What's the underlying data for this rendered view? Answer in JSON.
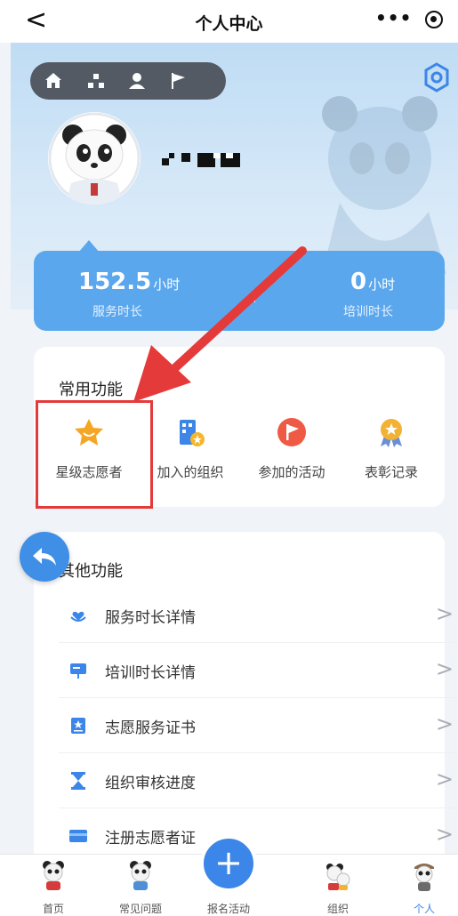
{
  "nav": {
    "back_glyph": "<",
    "title": "个人中心",
    "more_glyph": "•••",
    "icons": [
      "home-icon",
      "org-icon",
      "user-icon",
      "flag-icon"
    ]
  },
  "profile": {
    "name_masked": "▪▀ ▀▀▄"
  },
  "stats": {
    "service_hours": "152.5",
    "service_unit": "小时",
    "service_label": "服务时长",
    "training_hours": "0",
    "training_unit": "小时",
    "training_label": "培训时长"
  },
  "common": {
    "title": "常用功能",
    "items": [
      {
        "label": "星级志愿者",
        "icon": "star-icon",
        "color": "#f5a623"
      },
      {
        "label": "加入的组织",
        "icon": "building-icon",
        "color": "#3b86e8"
      },
      {
        "label": "参加的活动",
        "icon": "flag-icon",
        "color": "#ef5a45"
      },
      {
        "label": "表彰记录",
        "icon": "medal-icon",
        "color": "#f2b233"
      }
    ]
  },
  "other": {
    "title": "其他功能",
    "items": [
      {
        "label": "服务时长详情",
        "icon": "hand-heart-icon"
      },
      {
        "label": "培训时长详情",
        "icon": "presentation-icon"
      },
      {
        "label": "志愿服务证书",
        "icon": "certificate-icon"
      },
      {
        "label": "组织审核进度",
        "icon": "hourglass-icon"
      },
      {
        "label": "注册志愿者证",
        "icon": "card-icon"
      }
    ]
  },
  "tabbar": {
    "items": [
      {
        "label": "首页"
      },
      {
        "label": "常见问题"
      },
      {
        "label": "报名活动"
      },
      {
        "label": "组织"
      },
      {
        "label": "个人"
      }
    ],
    "plus_glyph": "+"
  },
  "colors": {
    "accent": "#3b86e8",
    "stats_card": "#5aa7ee",
    "annotation_red": "#e53a3a"
  }
}
